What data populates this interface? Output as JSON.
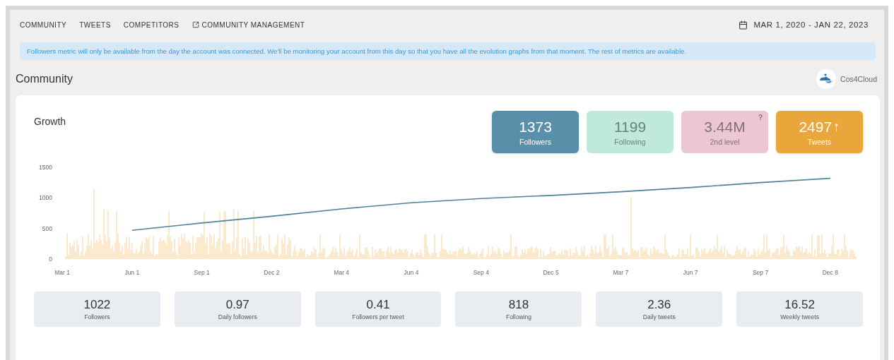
{
  "nav": {
    "items": [
      {
        "label": "COMMUNITY",
        "kind": "plain"
      },
      {
        "label": "TWEETS",
        "kind": "plain"
      },
      {
        "label": "COMPETITORS",
        "kind": "plain"
      },
      {
        "label": "COMMUNITY MANAGEMENT",
        "kind": "external"
      }
    ],
    "date_range": "MAR 1, 2020 - JAN 22, 2023"
  },
  "notice": "Followers metric will only be available from the day the account was connected. We'll be monitoring your account from this day so that you have all the evolution graphs from that moment. The rest of metrics are available.",
  "section": {
    "title": "Community",
    "account": "Cos4Cloud"
  },
  "growth": {
    "title": "Growth",
    "tiles": [
      {
        "value": "1373",
        "label": "Followers",
        "color": "#5a8fa9",
        "active": true
      },
      {
        "value": "1199",
        "label": "Following",
        "color": "#bfe9dc",
        "active": false
      },
      {
        "value": "3.44M",
        "label": "2nd level",
        "color": "#edc6d4",
        "active": false,
        "note": "?"
      },
      {
        "value": "2497",
        "label": "Tweets",
        "color": "#e9a63b",
        "active": true,
        "trend": "↑"
      }
    ],
    "chart_data": {
      "type": "line",
      "categories": [
        "Mar 1",
        "Jun 1",
        "Sep 1",
        "Dec 2",
        "Mar 4",
        "Jun 4",
        "Sep 4",
        "Dec 5",
        "Mar 7",
        "Jun 7",
        "Sep 7",
        "Dec 8"
      ],
      "yticks": [
        0,
        500,
        1000,
        1500
      ],
      "ylim": [
        0,
        1500
      ],
      "series": [
        {
          "color": "#4f8298",
          "values": [
            null,
            470,
            590,
            700,
            820,
            920,
            990,
            1040,
            1100,
            1170,
            1250,
            1320
          ]
        }
      ]
    }
  },
  "stats": [
    {
      "value": "1022",
      "label": "Followers"
    },
    {
      "value": "0.97",
      "label": "Daily followers"
    },
    {
      "value": "0.41",
      "label": "Followers per tweet"
    },
    {
      "value": "818",
      "label": "Following"
    },
    {
      "value": "2.36",
      "label": "Daily tweets"
    },
    {
      "value": "16.52",
      "label": "Weekly tweets"
    }
  ]
}
